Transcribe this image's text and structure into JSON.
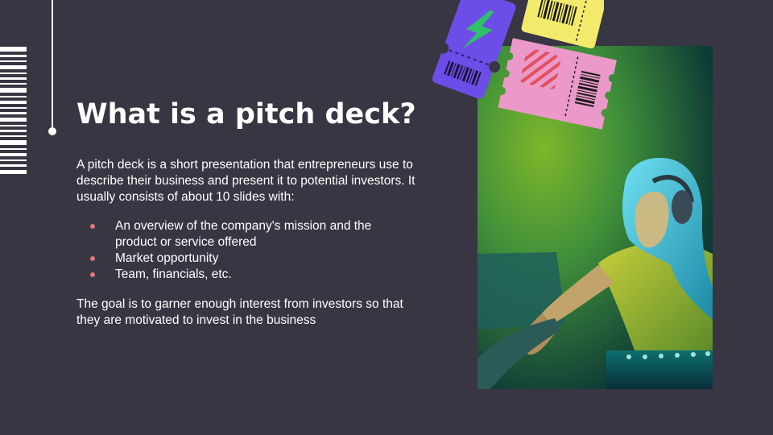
{
  "slide": {
    "title": "What is a pitch deck?",
    "intro": "A pitch deck is a short presentation that entrepreneurs use to describe their business and present it to potential investors. It usually consists of about 10 slides with:",
    "bullets": [
      "An overview of the company's mission and the product or service offered",
      "Market opportunity",
      "Team, financials, etc."
    ],
    "outro": "The goal is to garner enough interest from investors so that they are motivated to invest in the business"
  },
  "colors": {
    "background": "#383643",
    "bullet": "#e2757b",
    "ticket_purple": "#6d4de8",
    "ticket_yellow": "#f3ea6c",
    "ticket_pink": "#ea99c8",
    "lightning": "#2fc06a"
  },
  "icons": {
    "lightning": "lightning-icon",
    "barcode": "barcode-icon",
    "stripes": "striped-square-icon"
  }
}
